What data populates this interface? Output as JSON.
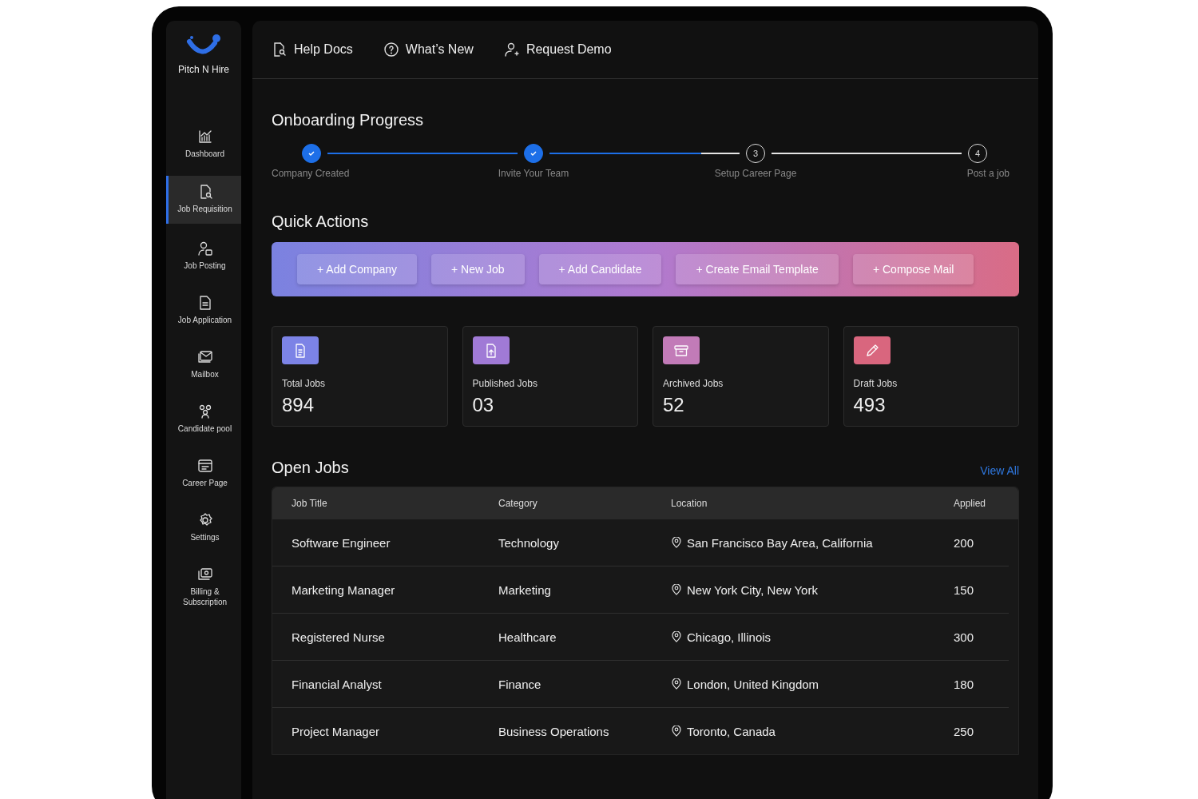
{
  "brand": {
    "name": "Pitch N Hire"
  },
  "sidebar": {
    "items": [
      {
        "label": "Dashboard",
        "selected": false
      },
      {
        "label": "Job Requisition",
        "selected": true
      },
      {
        "label": "Job Posting",
        "selected": false
      },
      {
        "label": "Job Application",
        "selected": false
      },
      {
        "label": "Mailbox",
        "selected": false
      },
      {
        "label": "Candidate pool",
        "selected": false
      },
      {
        "label": "Career Page",
        "selected": false
      },
      {
        "label": "Settings",
        "selected": false
      },
      {
        "label": "Billing & Subscription",
        "selected": false
      }
    ]
  },
  "top_links": [
    "Help Docs",
    "What’s New",
    "Request Demo"
  ],
  "onboarding": {
    "title": "Onboarding Progress",
    "steps": [
      {
        "label": "Company Created",
        "completed": true
      },
      {
        "label": "Invite Your Team",
        "completed": true
      },
      {
        "label": "Setup Career Page",
        "number": "3",
        "completed": false
      },
      {
        "label": "Post a job",
        "number": "4",
        "completed": false
      }
    ]
  },
  "quick_actions": {
    "title": "Quick Actions",
    "buttons": [
      "+ Add Company",
      "+ New Job",
      "+ Add Candidate",
      "+ Create Email Template",
      "+ Compose Mail"
    ]
  },
  "stats": [
    {
      "label": "Total Jobs",
      "value": "894",
      "color": "#7c83e6"
    },
    {
      "label": "Published Jobs",
      "value": "03",
      "color": "#a07ad6"
    },
    {
      "label": "Archived Jobs",
      "value": "52",
      "color": "#c27bb8"
    },
    {
      "label": "Draft Jobs",
      "value": "493",
      "color": "#d9667e"
    }
  ],
  "open_jobs": {
    "title": "Open Jobs",
    "view_all": "View All",
    "columns": [
      "Job Title",
      "Category",
      "Location",
      "Applied"
    ],
    "rows": [
      [
        "Software Engineer",
        "Technology",
        "San Francisco Bay Area, California",
        "200"
      ],
      [
        "Marketing Manager",
        "Marketing",
        "New York City, New York",
        "150"
      ],
      [
        "Registered Nurse",
        "Healthcare",
        "Chicago, Illinois",
        "300"
      ],
      [
        "Financial Analyst",
        "Finance",
        "London, United Kingdom",
        "180"
      ],
      [
        "Project Manager",
        "Business Operations",
        "Toronto, Canada",
        "250"
      ]
    ]
  }
}
